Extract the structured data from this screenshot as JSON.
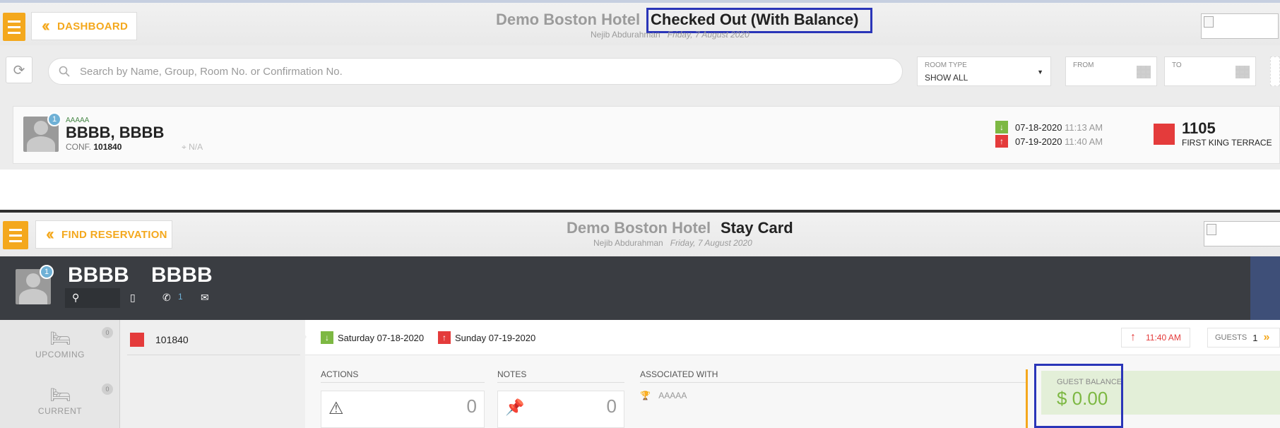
{
  "top": {
    "nav_label": "DASHBOARD",
    "hotel_name": "Demo Boston Hotel",
    "screen_title": "Checked Out (With Balance)",
    "user_name": "Nejib Abdurahman",
    "date": "Friday, 7 August 2020",
    "search_placeholder": "Search by Name, Group, Room No. or Confirmation No.",
    "room_type_label": "ROOM TYPE",
    "room_type_value": "SHOW ALL",
    "from_label": "FROM",
    "to_label": "TO",
    "reservation": {
      "badge": "1",
      "group": "AAAAA",
      "guest": "BBBB, BBBB",
      "conf_label": "CONF.",
      "conf_no": "101840",
      "location": "N/A",
      "arrival_date": "07-18-2020",
      "arrival_time": "11:13 AM",
      "departure_date": "07-19-2020",
      "departure_time": "11:40 AM",
      "room_no": "1105",
      "room_type": "FIRST KING TERRACE"
    }
  },
  "bottom": {
    "nav_label": "FIND RESERVATION",
    "hotel_name": "Demo Boston Hotel",
    "screen_title": "Stay Card",
    "user_name": "Nejib Abdurahman",
    "date": "Friday, 7 August 2020",
    "guest_badge": "1",
    "first_name": "BBBB",
    "last_name": "BBBB",
    "phone_count": "1",
    "upcoming_label": "UPCOMING",
    "upcoming_count": "0",
    "current_label": "CURRENT",
    "current_count": "0",
    "conf_no": "101840",
    "arrival": "Saturday 07-18-2020",
    "departure": "Sunday 07-19-2020",
    "checkout_time": "11:40 AM",
    "guests_label": "GUESTS",
    "guests_count": "1",
    "actions_label": "ACTIONS",
    "actions_count": "0",
    "notes_label": "NOTES",
    "notes_count": "0",
    "associated_label": "ASSOCIATED WITH",
    "associated_value": "AAAAA",
    "guest_balance_label": "GUEST BALANCE",
    "guest_balance_value": "$ 0.00"
  },
  "colors": {
    "accent": "#f4a81d",
    "highlight": "#2a35b8",
    "arrival": "#7db843",
    "departure": "#e43b3b",
    "balance": "#7db843"
  }
}
